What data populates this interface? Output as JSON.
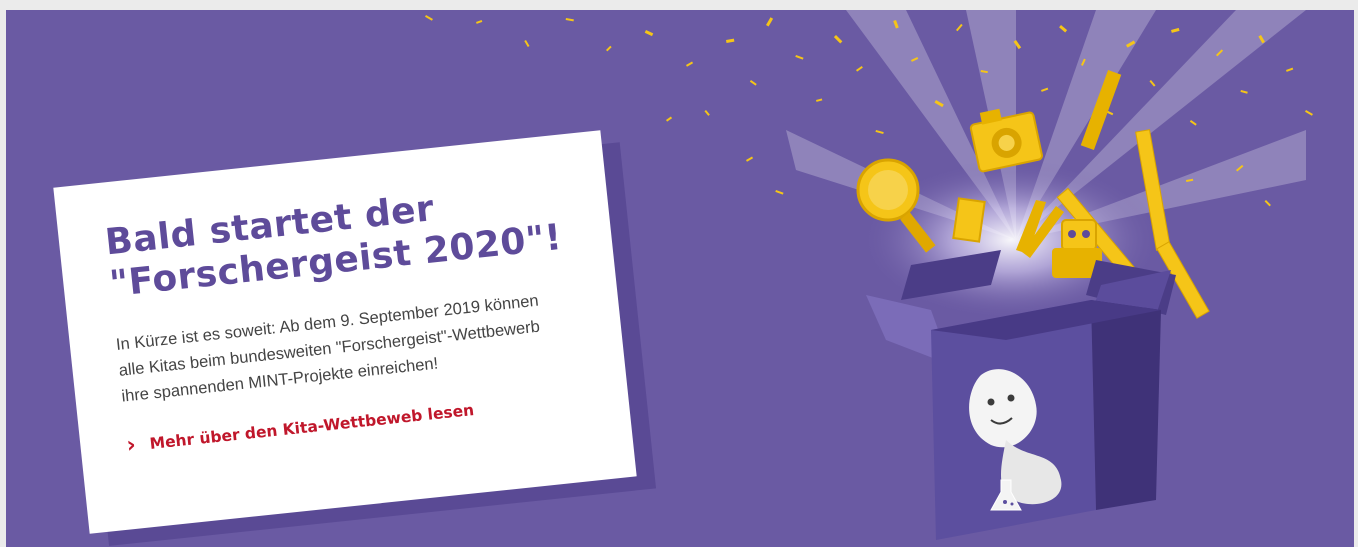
{
  "teaser": {
    "title_line1": "Bald startet der",
    "title_line2": "\"Forschergeist 2020\"!",
    "body": "In Kürze ist es soweit: Ab dem 9. September 2019 können alle Kitas beim bundesweiten \"Forschergeist\"-Wettbewerb ihre spannenden MINT-Projekte einreichen!",
    "link_label": "Mehr über den Kita-Wettbeweb lesen",
    "link_icon": "chevron-right-icon"
  },
  "colors": {
    "background": "#6a5aa3",
    "title": "#5e4b9a",
    "link": "#c0172b",
    "confetti": "#f5c518"
  },
  "illustration": {
    "name": "surprise-box-illustration",
    "icons": [
      "camera-icon",
      "magnifier-icon",
      "pliers-icon",
      "robot-icon",
      "folding-ruler-icon",
      "ghost-mascot-icon",
      "flask-icon"
    ]
  }
}
